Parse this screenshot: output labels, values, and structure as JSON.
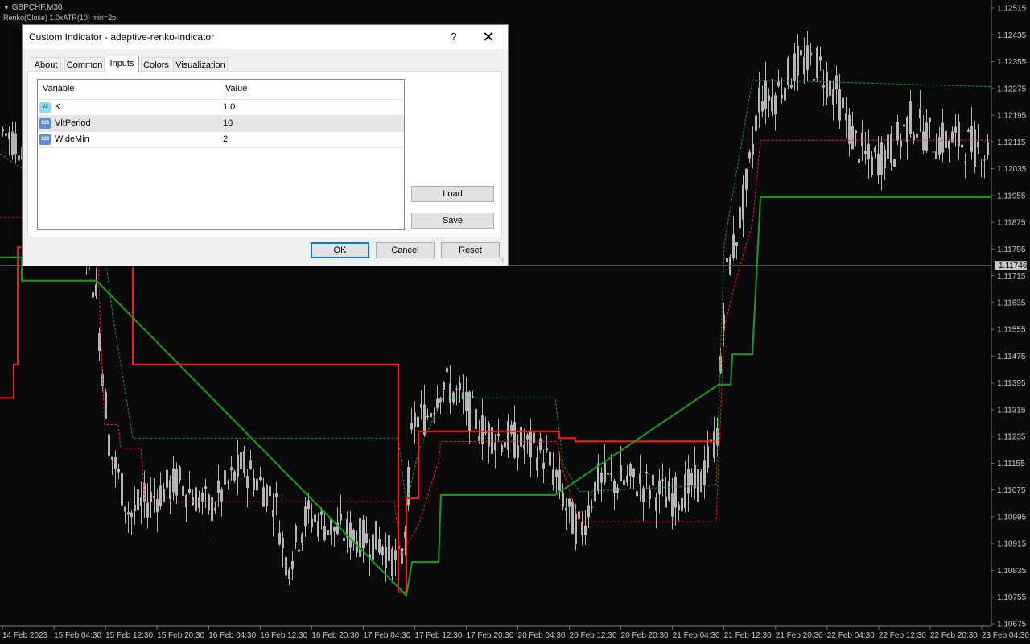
{
  "header": {
    "symbol": "GBPCHF,M30",
    "indicator": "Renko(Close) 1.0xATR(10) min=2p."
  },
  "colors": {
    "background": "#0a0a0d",
    "candles": "#b5b5b5",
    "renko_down": "#ff1a1a",
    "renko_up": "#1a9e1a"
  },
  "dialog": {
    "title": "Custom Indicator - adaptive-renko-indicator",
    "help": "?",
    "close": "✕",
    "tabs": [
      "About",
      "Common",
      "Inputs",
      "Colors",
      "Visualization"
    ],
    "active_tab": "Inputs",
    "columns": [
      "Variable",
      "Value"
    ],
    "rows": [
      {
        "icon": "V2",
        "name": "K",
        "value": "1.0"
      },
      {
        "icon": "123",
        "name": "VltPeriod",
        "value": "10"
      },
      {
        "icon": "123",
        "name": "WideMin",
        "value": "2"
      }
    ],
    "selected_row": 1,
    "buttons": {
      "load": "Load",
      "save": "Save",
      "ok": "OK",
      "cancel": "Cancel",
      "reset": "Reset"
    }
  },
  "chart_data": {
    "type": "candlestick",
    "title": "GBPCHF,M30",
    "ylim": [
      1.10675,
      1.12515
    ],
    "current_price": "1.11746",
    "y_ticks": [
      "1.12515",
      "1.12435",
      "1.12355",
      "1.12275",
      "1.12195",
      "1.12115",
      "1.12035",
      "1.11955",
      "1.11875",
      "1.11795",
      "1.11715",
      "1.11635",
      "1.11555",
      "1.11475",
      "1.11395",
      "1.11315",
      "1.11235",
      "1.11155",
      "1.11075",
      "1.10995",
      "1.10915",
      "1.10835",
      "1.10755",
      "1.10675"
    ],
    "x_ticks": [
      "14 Feb 2023",
      "15 Feb 04:30",
      "15 Feb 12:30",
      "15 Feb 20:30",
      "16 Feb 04:30",
      "16 Feb 12:30",
      "16 Feb 20:30",
      "17 Feb 04:30",
      "17 Feb 12:30",
      "17 Feb 20:30",
      "20 Feb 04:30",
      "20 Feb 12:30",
      "20 Feb 20:30",
      "21 Feb 04:30",
      "21 Feb 12:30",
      "21 Feb 20:30",
      "22 Feb 04:30",
      "22 Feb 12:30",
      "22 Feb 20:30",
      "23 Feb 04:30"
    ],
    "renko_upper_solid": [
      [
        0,
        1.1135
      ],
      [
        17,
        1.1135
      ],
      [
        17,
        1.1145
      ],
      [
        22,
        1.1145
      ],
      [
        22,
        1.118
      ],
      [
        44,
        1.118
      ],
      [
        44,
        1.119
      ],
      [
        140,
        1.119
      ],
      [
        140,
        1.1175
      ],
      [
        165,
        1.1175
      ],
      [
        165,
        1.1145
      ],
      [
        495,
        1.1145
      ],
      [
        495,
        1.1077
      ],
      [
        505,
        1.1077
      ],
      [
        505,
        1.1105
      ],
      [
        520,
        1.1105
      ],
      [
        520,
        1.1125
      ],
      [
        695,
        1.1125
      ],
      [
        695,
        1.1123
      ],
      [
        715,
        1.1123
      ],
      [
        715,
        1.1122
      ],
      [
        890,
        1.1122
      ]
    ],
    "renko_lower_solid": [
      [
        0,
        1.1177
      ],
      [
        27,
        1.1177
      ],
      [
        27,
        1.117
      ],
      [
        120,
        1.117
      ],
      [
        505,
        1.1076
      ],
      [
        512,
        1.1086
      ],
      [
        545,
        1.1086
      ],
      [
        548,
        1.1106
      ],
      [
        690,
        1.1106
      ],
      [
        893,
        1.1139
      ],
      [
        908,
        1.1139
      ],
      [
        910,
        1.1148
      ],
      [
        935,
        1.1148
      ],
      [
        945,
        1.1195
      ],
      [
        1232,
        1.1195
      ]
    ],
    "renko_upper_dashed": [
      [
        0,
        1.1189
      ],
      [
        120,
        1.1189
      ],
      [
        125,
        1.1155
      ],
      [
        130,
        1.1127
      ],
      [
        147,
        1.1127
      ],
      [
        150,
        1.112
      ],
      [
        175,
        1.112
      ],
      [
        180,
        1.1104
      ],
      [
        490,
        1.1104
      ],
      [
        498,
        1.1088
      ],
      [
        520,
        1.1097
      ],
      [
        545,
        1.1116
      ],
      [
        548,
        1.1122
      ],
      [
        692,
        1.1122
      ],
      [
        700,
        1.1113
      ],
      [
        720,
        1.1098
      ],
      [
        890,
        1.1098
      ],
      [
        900,
        1.1156
      ],
      [
        910,
        1.1166
      ],
      [
        925,
        1.1179
      ],
      [
        935,
        1.1187
      ],
      [
        945,
        1.1212
      ],
      [
        1232,
        1.1212
      ]
    ],
    "renko_lower_dashed": [
      [
        0,
        1.1208
      ],
      [
        125,
        1.1188
      ],
      [
        140,
        1.116
      ],
      [
        165,
        1.1123
      ],
      [
        495,
        1.1123
      ],
      [
        505,
        1.1103
      ],
      [
        520,
        1.1119
      ],
      [
        550,
        1.1135
      ],
      [
        690,
        1.1135
      ],
      [
        700,
        1.1115
      ],
      [
        720,
        1.1107
      ],
      [
        890,
        1.1109
      ],
      [
        900,
        1.1181
      ],
      [
        935,
        1.123
      ],
      [
        945,
        1.123
      ],
      [
        1232,
        1.1228
      ]
    ]
  }
}
